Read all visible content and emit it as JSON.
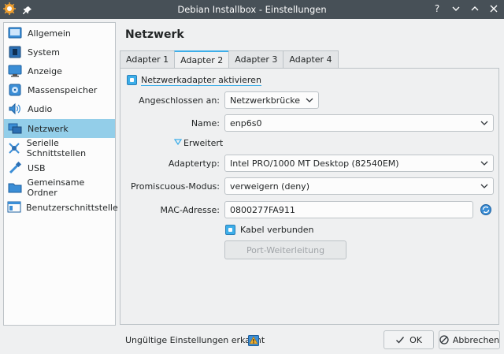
{
  "window": {
    "title": "Debian Installbox - Einstellungen"
  },
  "sidebar": {
    "items": [
      {
        "label": "Allgemein",
        "icon": "general-icon"
      },
      {
        "label": "System",
        "icon": "system-icon"
      },
      {
        "label": "Anzeige",
        "icon": "display-icon"
      },
      {
        "label": "Massenspeicher",
        "icon": "storage-icon"
      },
      {
        "label": "Audio",
        "icon": "audio-icon"
      },
      {
        "label": "Netzwerk",
        "icon": "network-icon",
        "active": true
      },
      {
        "label": "Serielle Schnittstellen",
        "icon": "serial-icon"
      },
      {
        "label": "USB",
        "icon": "usb-icon"
      },
      {
        "label": "Gemeinsame Ordner",
        "icon": "folder-icon"
      },
      {
        "label": "Benutzerschnittstelle",
        "icon": "ui-icon"
      }
    ]
  },
  "page": {
    "heading": "Netzwerk"
  },
  "tabs": [
    {
      "label": "Adapter 1"
    },
    {
      "label": "Adapter 2",
      "active": true
    },
    {
      "label": "Adapter 3"
    },
    {
      "label": "Adapter 4"
    }
  ],
  "form": {
    "enable_label": "Netzwerkadapter aktivieren",
    "attached_label": "Angeschlossen an:",
    "attached_value": "Netzwerkbrücke",
    "name_label": "Name:",
    "name_value": "enp6s0",
    "advanced_label": "Erweitert",
    "adapter_type_label": "Adaptertyp:",
    "adapter_type_value": "Intel PRO/1000 MT Desktop (82540EM)",
    "promisc_label": "Promiscuous-Modus:",
    "promisc_value": "verweigern (deny)",
    "mac_label": "MAC-Adresse:",
    "mac_value": "0800277FA911",
    "cable_label": "Kabel verbunden",
    "port_forward_label": "Port-Weiterleitung"
  },
  "footer": {
    "status_text": "Ungültige Einstellungen erkannt",
    "ok_label": "OK",
    "cancel_label": "Abbrechen"
  },
  "colors": {
    "accent": "#3daee9",
    "selection": "#93cee9",
    "titlebar": "#475057"
  }
}
